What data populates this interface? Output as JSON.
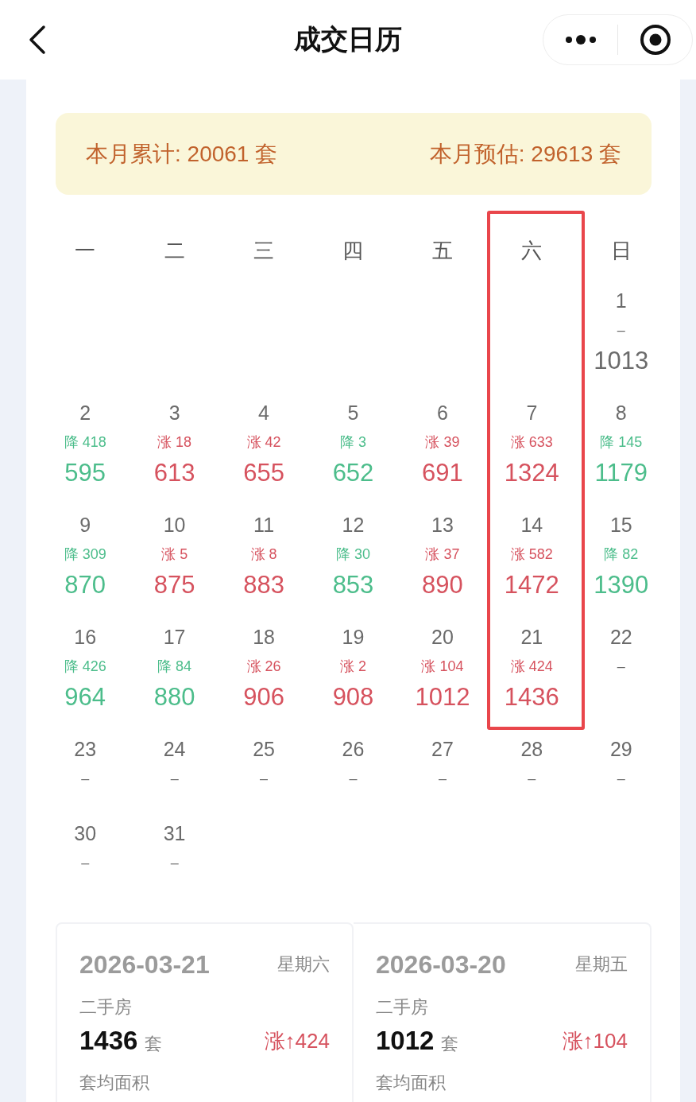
{
  "nav": {
    "title": "成交日历"
  },
  "summary": {
    "month_total": "本月累计: 20061 套",
    "month_estimate": "本月预估: 29613 套"
  },
  "weekdays": [
    {
      "label": "一",
      "highlighted": false
    },
    {
      "label": "二",
      "highlighted": false
    },
    {
      "label": "三",
      "highlighted": false
    },
    {
      "label": "四",
      "highlighted": false
    },
    {
      "label": "五",
      "highlighted": false
    },
    {
      "label": "六",
      "highlighted": true
    },
    {
      "label": "日",
      "highlighted": false
    }
  ],
  "weeks": [
    [
      {
        "kind": "blank"
      },
      {
        "kind": "blank"
      },
      {
        "kind": "blank"
      },
      {
        "kind": "blank"
      },
      {
        "kind": "blank"
      },
      {
        "kind": "blank"
      },
      {
        "kind": "day",
        "day": "1",
        "color": "#6b6b6b",
        "change": "–",
        "count": "1013"
      }
    ],
    [
      {
        "kind": "day",
        "day": "2",
        "color": "#4cbd8b",
        "change": "降 418",
        "count": "595"
      },
      {
        "kind": "day",
        "day": "3",
        "color": "#d6525e",
        "change": "涨 18",
        "count": "613"
      },
      {
        "kind": "day",
        "day": "4",
        "color": "#d6525e",
        "change": "涨 42",
        "count": "655"
      },
      {
        "kind": "day",
        "day": "5",
        "color": "#4cbd8b",
        "change": "降 3",
        "count": "652"
      },
      {
        "kind": "day",
        "day": "6",
        "color": "#d6525e",
        "change": "涨 39",
        "count": "691"
      },
      {
        "kind": "day",
        "day": "7",
        "color": "#d6525e",
        "change": "涨 633",
        "count": "1324"
      },
      {
        "kind": "day",
        "day": "8",
        "color": "#4cbd8b",
        "change": "降 145",
        "count": "1179"
      }
    ],
    [
      {
        "kind": "day",
        "day": "9",
        "color": "#4cbd8b",
        "change": "降 309",
        "count": "870"
      },
      {
        "kind": "day",
        "day": "10",
        "color": "#d6525e",
        "change": "涨 5",
        "count": "875"
      },
      {
        "kind": "day",
        "day": "11",
        "color": "#d6525e",
        "change": "涨 8",
        "count": "883"
      },
      {
        "kind": "day",
        "day": "12",
        "color": "#4cbd8b",
        "change": "降 30",
        "count": "853"
      },
      {
        "kind": "day",
        "day": "13",
        "color": "#d6525e",
        "change": "涨 37",
        "count": "890"
      },
      {
        "kind": "day",
        "day": "14",
        "color": "#d6525e",
        "change": "涨 582",
        "count": "1472"
      },
      {
        "kind": "day",
        "day": "15",
        "color": "#4cbd8b",
        "change": "降 82",
        "count": "1390"
      }
    ],
    [
      {
        "kind": "day",
        "day": "16",
        "color": "#4cbd8b",
        "change": "降 426",
        "count": "964"
      },
      {
        "kind": "day",
        "day": "17",
        "color": "#4cbd8b",
        "change": "降 84",
        "count": "880"
      },
      {
        "kind": "day",
        "day": "18",
        "color": "#d6525e",
        "change": "涨 26",
        "count": "906"
      },
      {
        "kind": "day",
        "day": "19",
        "color": "#d6525e",
        "change": "涨 2",
        "count": "908"
      },
      {
        "kind": "day",
        "day": "20",
        "color": "#d6525e",
        "change": "涨 104",
        "count": "1012"
      },
      {
        "kind": "day",
        "day": "21",
        "color": "#d6525e",
        "change": "涨 424",
        "count": "1436"
      },
      {
        "kind": "day",
        "day": "22",
        "color": "#6b6b6b",
        "change": "–"
      }
    ],
    [
      {
        "kind": "day",
        "day": "23",
        "color": "#6b6b6b",
        "change": "–"
      },
      {
        "kind": "day",
        "day": "24",
        "color": "#6b6b6b",
        "change": "–"
      },
      {
        "kind": "day",
        "day": "25",
        "color": "#6b6b6b",
        "change": "–"
      },
      {
        "kind": "day",
        "day": "26",
        "color": "#6b6b6b",
        "change": "–"
      },
      {
        "kind": "day",
        "day": "27",
        "color": "#6b6b6b",
        "change": "–"
      },
      {
        "kind": "day",
        "day": "28",
        "color": "#6b6b6b",
        "change": "–"
      },
      {
        "kind": "day",
        "day": "29",
        "color": "#6b6b6b",
        "change": "–"
      }
    ],
    [
      {
        "kind": "day",
        "day": "30",
        "color": "#6b6b6b",
        "change": "–"
      },
      {
        "kind": "day",
        "day": "31",
        "color": "#6b6b6b",
        "change": "–"
      }
    ]
  ],
  "cards": [
    {
      "date": "2026-03-21",
      "weekday": "星期六",
      "category": "二手房",
      "count": "1436",
      "unit": "套",
      "color": "#d6525e",
      "change": "涨↑424",
      "area_label": "套均面积"
    },
    {
      "date": "2026-03-20",
      "weekday": "星期五",
      "category": "二手房",
      "count": "1012",
      "unit": "套",
      "color": "#d6525e",
      "change": "涨↑104",
      "area_label": "套均面积"
    }
  ]
}
